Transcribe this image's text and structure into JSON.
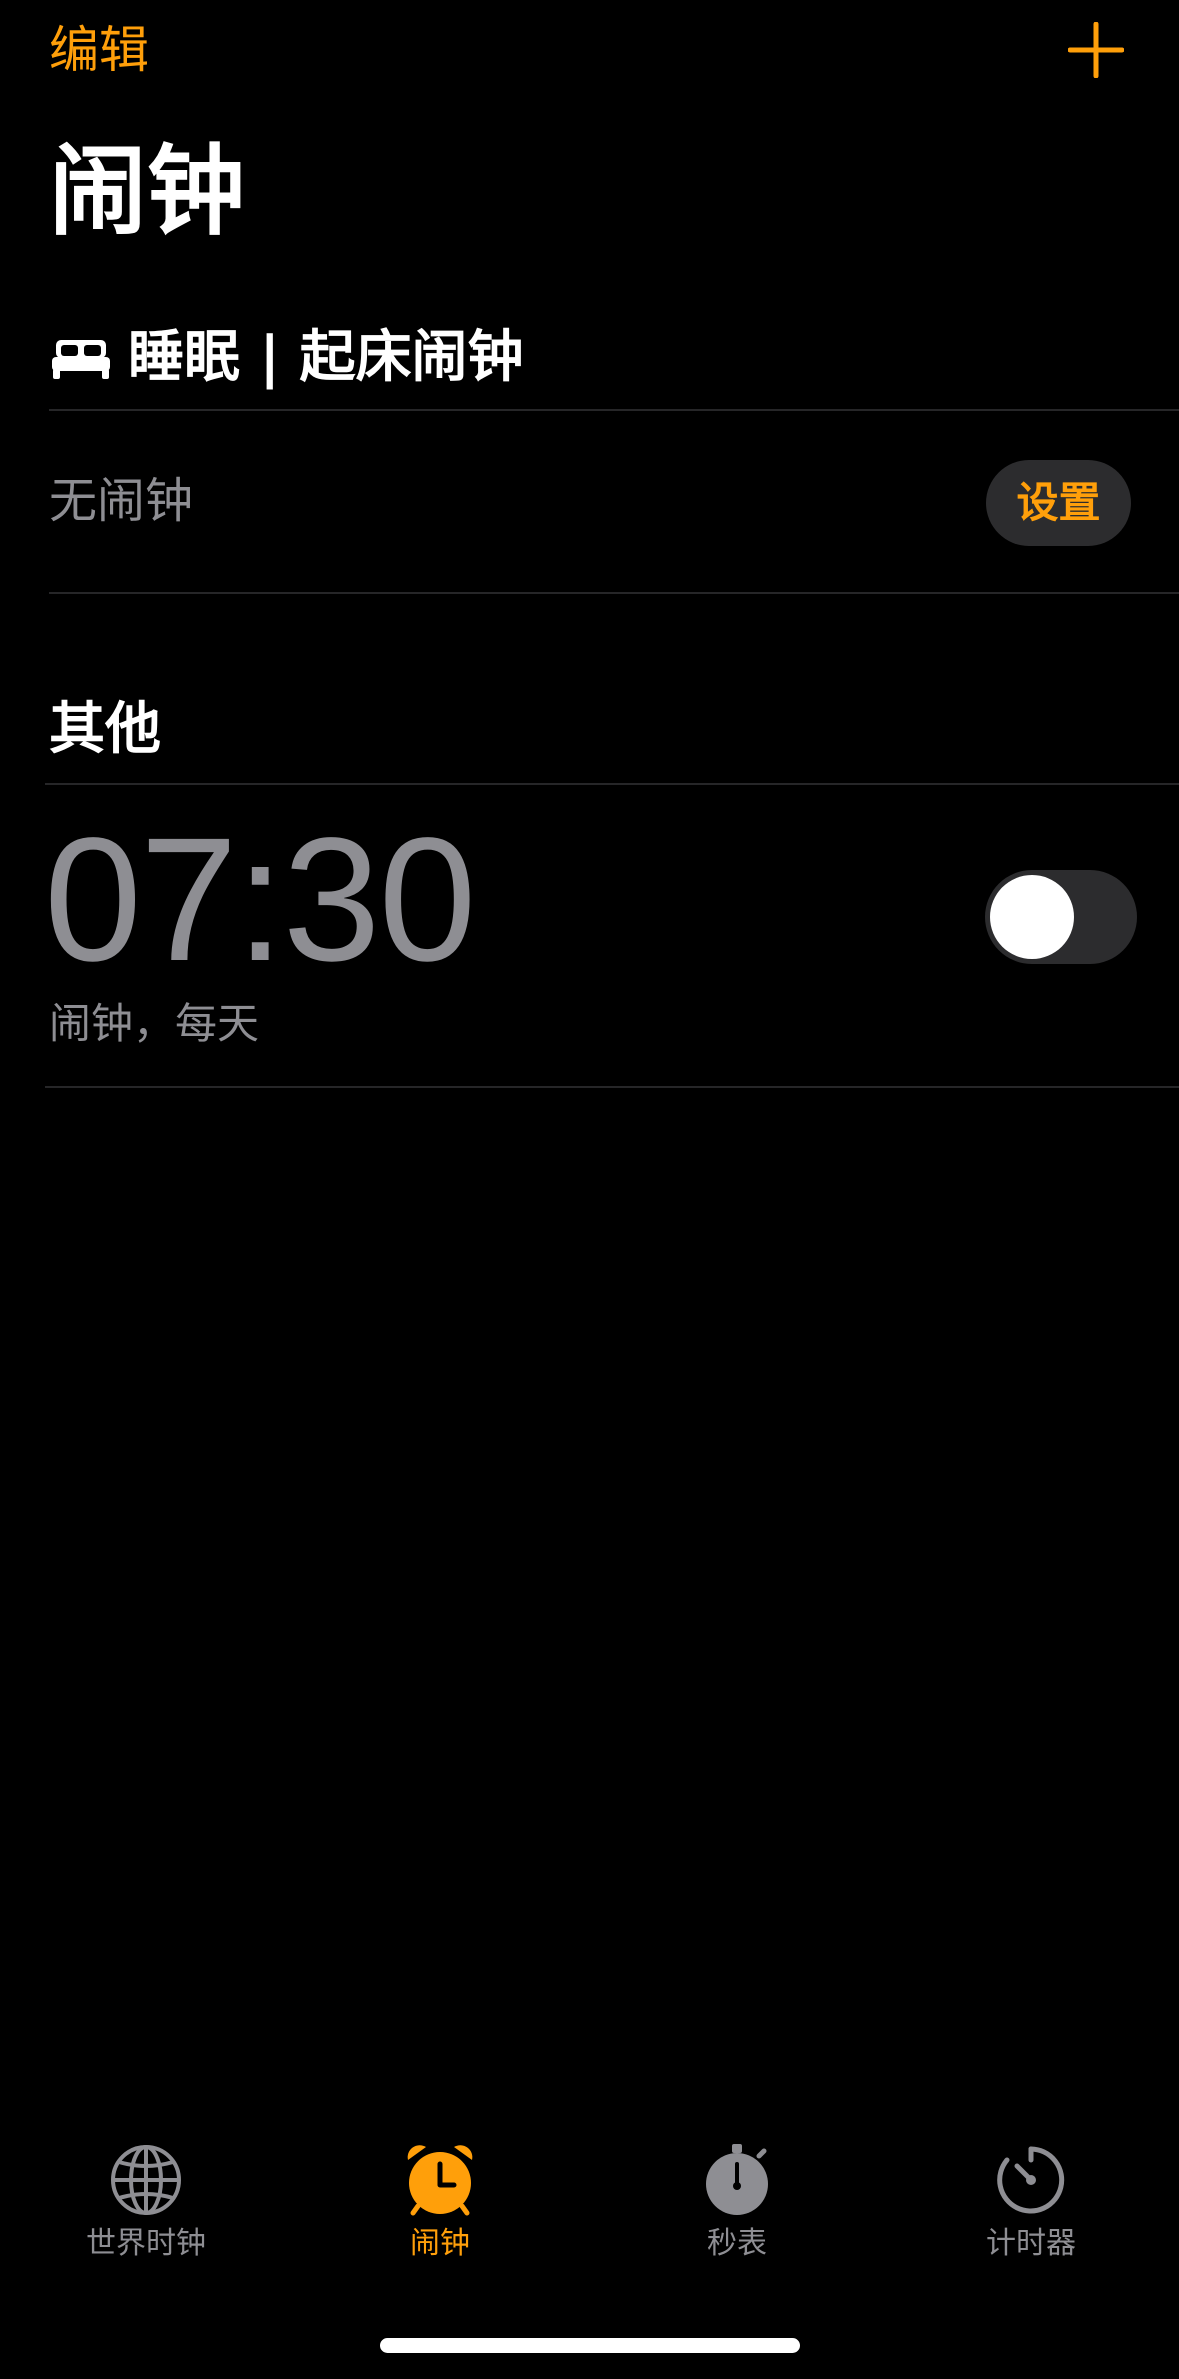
{
  "header": {
    "edit_label": "编辑",
    "add_icon": "plus-icon",
    "title": "闹钟"
  },
  "sleep_section": {
    "icon": "bed-icon",
    "title": "睡眠 | 起床闹钟",
    "status": "无闹钟",
    "setup_label": "设置"
  },
  "other_section": {
    "title": "其他",
    "alarms": [
      {
        "time": "07:30",
        "label": "闹钟，每天",
        "enabled": false
      }
    ]
  },
  "tab_bar": {
    "active_tab": "闹钟",
    "tabs": [
      {
        "label": "世界时钟",
        "icon": "globe-icon"
      },
      {
        "label": "闹钟",
        "icon": "alarm-clock-icon"
      },
      {
        "label": "秒表",
        "icon": "stopwatch-icon"
      },
      {
        "label": "计时器",
        "icon": "timer-icon"
      }
    ]
  },
  "colors": {
    "accent": "#ff9f0a",
    "background": "#000000",
    "secondary_text": "#8e8e93",
    "fill": "#2c2c2e"
  }
}
